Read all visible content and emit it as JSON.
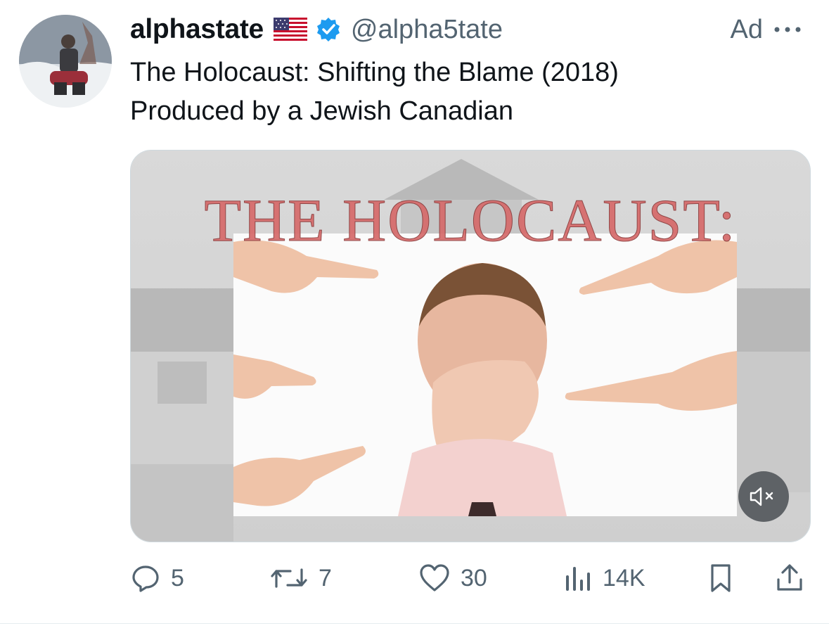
{
  "author": {
    "name": "alphastate",
    "flag": "US flag emoji",
    "verified": true,
    "handle": "@alpha5tate"
  },
  "promoted_label": "Ad",
  "post_text": "The Holocaust: Shifting the Blame (2018)\nProduced by a Jewish Canadian",
  "media": {
    "overlay_title": "THE HOLOCAUST:",
    "muted": true
  },
  "actions": {
    "replies": "5",
    "reposts": "7",
    "likes": "30",
    "views": "14K"
  },
  "colors": {
    "text": "#0f1419",
    "secondary": "#536471",
    "verified_blue": "#1d9bf0",
    "title_red": "#d66a6a"
  },
  "icons": [
    "more-icon",
    "verified-icon",
    "reply-icon",
    "repost-icon",
    "like-icon",
    "views-icon",
    "bookmark-icon",
    "share-icon",
    "mute-icon"
  ]
}
